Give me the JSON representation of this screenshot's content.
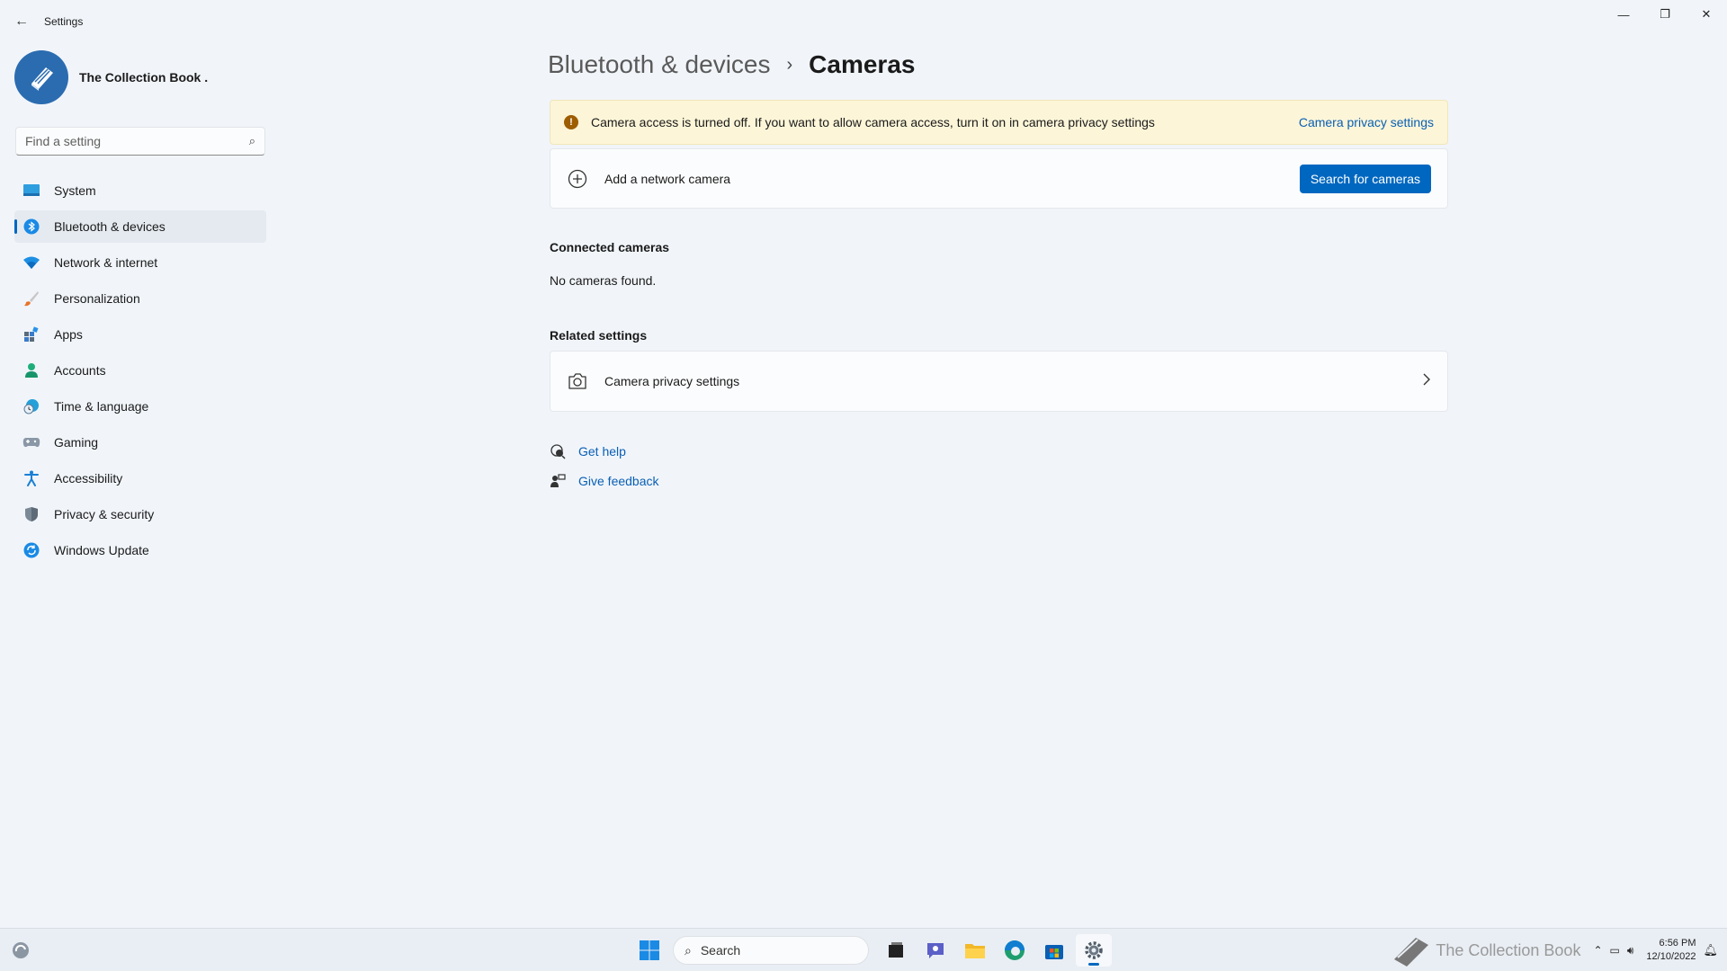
{
  "window": {
    "app_title": "Settings",
    "back_label": "←",
    "minimize": "—",
    "restore": "❐",
    "close": "✕"
  },
  "profile": {
    "name": "The Collection Book ."
  },
  "search": {
    "placeholder": "Find a setting"
  },
  "nav": {
    "items": [
      {
        "label": "System",
        "icon": "system-icon"
      },
      {
        "label": "Bluetooth & devices",
        "icon": "bluetooth-icon",
        "active": true
      },
      {
        "label": "Network & internet",
        "icon": "wifi-icon"
      },
      {
        "label": "Personalization",
        "icon": "brush-icon"
      },
      {
        "label": "Apps",
        "icon": "apps-icon"
      },
      {
        "label": "Accounts",
        "icon": "person-icon"
      },
      {
        "label": "Time & language",
        "icon": "globe-clock-icon"
      },
      {
        "label": "Gaming",
        "icon": "controller-icon"
      },
      {
        "label": "Accessibility",
        "icon": "accessibility-icon"
      },
      {
        "label": "Privacy & security",
        "icon": "shield-icon"
      },
      {
        "label": "Windows Update",
        "icon": "update-icon"
      }
    ]
  },
  "breadcrumb": {
    "parent": "Bluetooth & devices",
    "separator": "›",
    "current": "Cameras"
  },
  "alert": {
    "text": "Camera access is turned off. If you want to allow camera access, turn it on in camera privacy settings",
    "link": "Camera privacy settings"
  },
  "add_camera": {
    "label": "Add a network camera",
    "button": "Search for cameras"
  },
  "connected": {
    "title": "Connected cameras",
    "empty": "No cameras found."
  },
  "related": {
    "title": "Related settings",
    "item_label": "Camera privacy settings"
  },
  "help": {
    "get_help": "Get help",
    "give_feedback": "Give feedback"
  },
  "taskbar": {
    "search_label": "Search",
    "time": "6:56 PM",
    "date": "12/10/2022",
    "watermark": "The Collection Book"
  },
  "colors": {
    "accent": "#0067c0",
    "alert_bg": "#fcf5d8",
    "alert_icon": "#9d5d00",
    "link": "#0a5fb4"
  }
}
